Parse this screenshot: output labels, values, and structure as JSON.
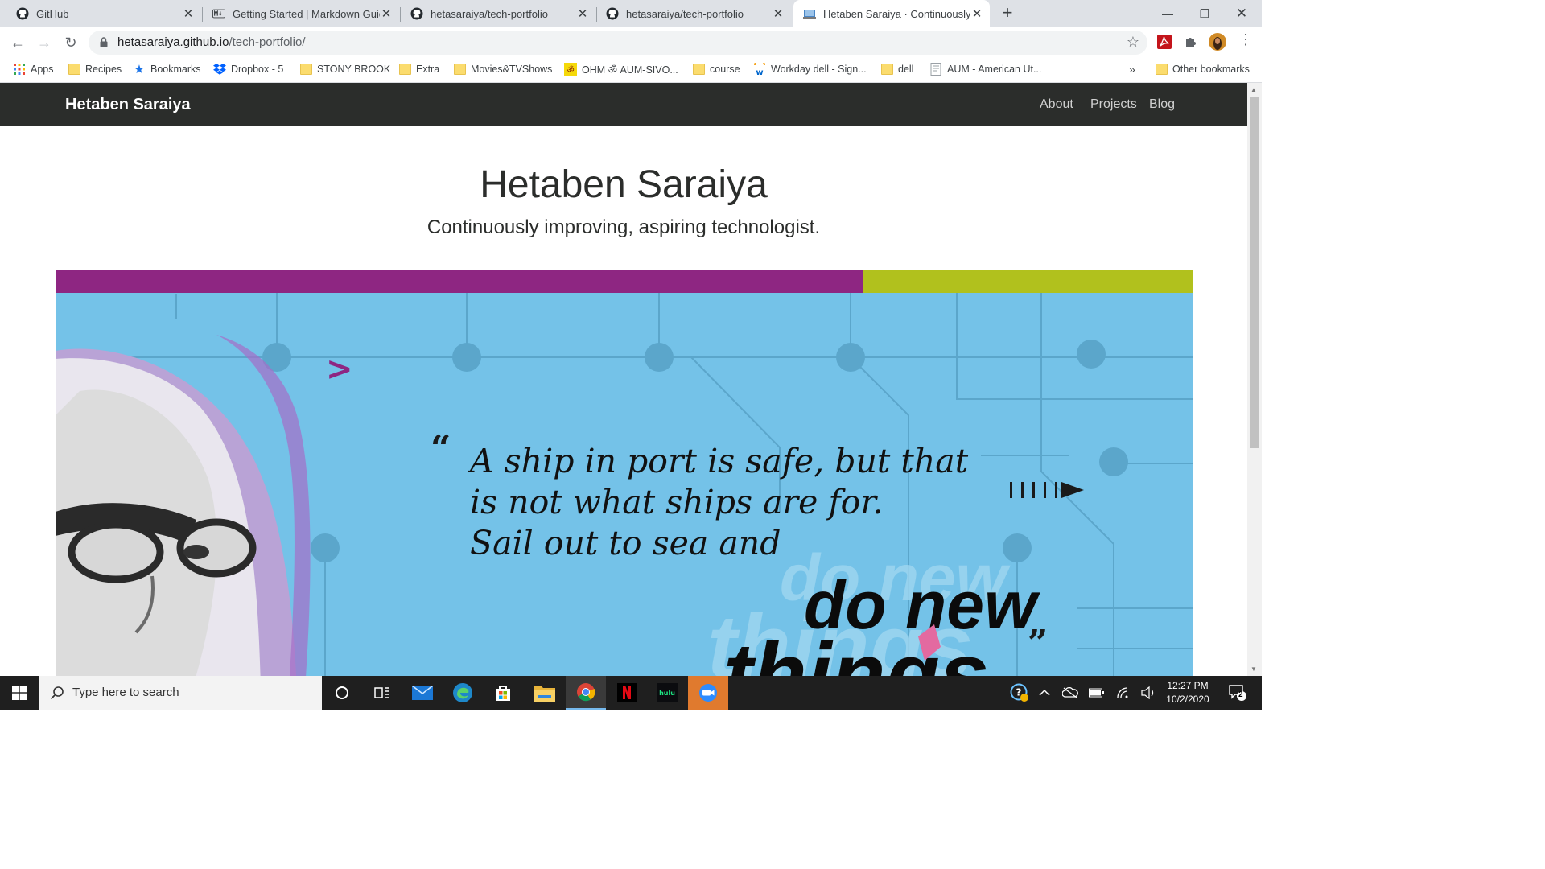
{
  "browser": {
    "tabs": [
      {
        "title": "GitHub",
        "icon": "github-icon",
        "active": false
      },
      {
        "title": "Getting Started | Markdown Guid",
        "icon": "markdown-icon",
        "active": false
      },
      {
        "title": "hetasaraiya/tech-portfolio",
        "icon": "github-icon",
        "active": false
      },
      {
        "title": "hetasaraiya/tech-portfolio",
        "icon": "github-icon",
        "active": false
      },
      {
        "title": "Hetaben Saraiya · Continuously i",
        "icon": "page-icon",
        "active": true
      }
    ],
    "new_tab": "+",
    "url": {
      "host": "hetasaraiya.github.io",
      "path": "/tech-portfolio/"
    },
    "bookmarks": [
      {
        "label": "Apps",
        "icon": "apps-grid-icon"
      },
      {
        "label": "Recipes",
        "icon": "folder-icon"
      },
      {
        "label": "Bookmarks",
        "icon": "star-icon"
      },
      {
        "label": "Dropbox - 5",
        "icon": "dropbox-icon"
      },
      {
        "label": "STONY BROOK",
        "icon": "folder-icon"
      },
      {
        "label": "Extra",
        "icon": "folder-icon"
      },
      {
        "label": "Movies&TVShows",
        "icon": "folder-icon"
      },
      {
        "label": "OHM ॐ AUM-SIVO...",
        "icon": "om-icon"
      },
      {
        "label": "course",
        "icon": "folder-icon"
      },
      {
        "label": "Workday dell - Sign...",
        "icon": "workday-icon"
      },
      {
        "label": "dell",
        "icon": "folder-icon"
      },
      {
        "label": "AUM - American Ut...",
        "icon": "document-icon"
      }
    ],
    "bookmarks_overflow": "»",
    "other_bookmarks": "Other bookmarks"
  },
  "site": {
    "brand": "Hetaben Saraiya",
    "nav": [
      "About",
      "Projects",
      "Blog"
    ],
    "headline": "Hetaben Saraiya",
    "tagline": "Continuously improving, aspiring technologist.",
    "banner": {
      "open_quote": "“",
      "quote_lines": [
        "A ship in port is safe, but that",
        "is not what ships are for.",
        "Sail out to sea and"
      ],
      "emphasis_lines": [
        "do new",
        "things"
      ],
      "close_quote": "”",
      "colors": {
        "sky": "#74c2e8",
        "purple": "#8e2682",
        "lime": "#b1c11d",
        "circuit": "#5ba6cb"
      }
    }
  },
  "taskbar": {
    "search_placeholder": "Type here to search",
    "apps": [
      "cortana-icon",
      "task-view-icon",
      "mail-icon",
      "edge-icon",
      "store-icon",
      "file-explorer-icon",
      "chrome-icon",
      "netflix-icon",
      "hulu-icon",
      "zoom-icon"
    ],
    "time": "12:27 PM",
    "date": "10/2/2020",
    "notification_count": "2"
  }
}
